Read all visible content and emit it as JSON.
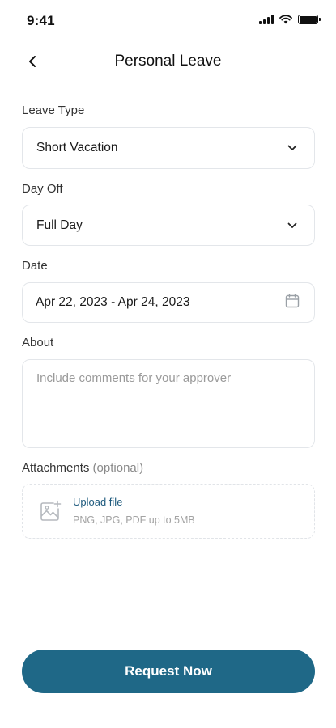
{
  "status_bar": {
    "time": "9:41",
    "icons": [
      "cellular-signal-icon",
      "wifi-icon",
      "battery-icon"
    ]
  },
  "header": {
    "title": "Personal Leave",
    "back_icon": "chevron-left-icon"
  },
  "form": {
    "leave_type": {
      "label": "Leave Type",
      "value": "Short Vacation",
      "icon": "chevron-down-icon"
    },
    "day_off": {
      "label": "Day Off",
      "value": "Full Day",
      "icon": "chevron-down-icon"
    },
    "date": {
      "label": "Date",
      "value": "Apr 22, 2023 - Apr 24, 2023",
      "icon": "calendar-icon"
    },
    "about": {
      "label": "About",
      "value": "",
      "placeholder": "Include comments for your approver"
    },
    "attachments": {
      "label": "Attachments",
      "label_suffix": "(optional)",
      "upload_label": "Upload file",
      "hint": "PNG, JPG, PDF up to 5MB",
      "icon": "image-add-icon"
    }
  },
  "actions": {
    "submit_label": "Request Now"
  },
  "colors": {
    "primary": "#1f6887",
    "link": "#1f5b7e",
    "border": "#e3e6ea",
    "placeholder": "#9a9a9a"
  }
}
